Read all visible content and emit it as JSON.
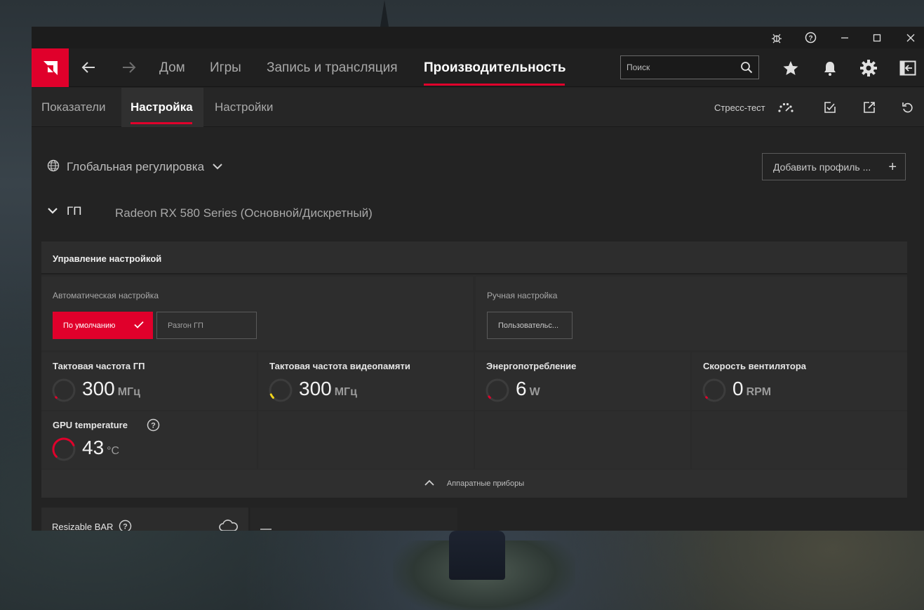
{
  "topnav": {
    "items": [
      "Дом",
      "Игры",
      "Запись и трансляция",
      "Производительность"
    ],
    "active": "Производительность",
    "search_placeholder": "Поиск"
  },
  "subnav": {
    "tabs": [
      "Показатели",
      "Настройка",
      "Настройки"
    ],
    "active": "Настройка",
    "stress_test": "Стресс-тест"
  },
  "profile": {
    "label": "Глобальная регулировка",
    "add_profile": "Добавить профиль ..."
  },
  "gpu": {
    "label": "ГП",
    "name": "Radeon RX 580 Series (Основной/Дискретный)"
  },
  "tuning": {
    "title": "Управление настройкой",
    "auto_label": "Автоматическая настройка",
    "default_btn": "По умолчанию",
    "oc_btn": "Разгон ГП",
    "manual_label": "Ручная настройка",
    "custom_btn": "Пользовательс..."
  },
  "metrics": [
    {
      "title": "Тактовая частота ГП",
      "value": "300",
      "unit": "МГц",
      "fraction": 0.0,
      "color": "#e0002b"
    },
    {
      "title": "Тактовая частота видеопамяти",
      "value": "300",
      "unit": "МГц",
      "fraction": 0.08,
      "color": "#f2d51c"
    },
    {
      "title": "Энергопотребление",
      "value": "6",
      "unit": "W",
      "fraction": 0.03,
      "color": "#e0002b"
    },
    {
      "title": "Скорость вентилятора",
      "value": "0",
      "unit": "RPM",
      "fraction": 0.0,
      "color": "#e0002b"
    },
    {
      "title": "GPU temperature",
      "value": "43",
      "unit": "°C",
      "fraction": 0.75,
      "color": "#e0002b"
    }
  ],
  "hardware_toggle": "Аппаратные приборы",
  "resizable_bar": "Resizable BAR",
  "colors": {
    "accent": "#e0002b",
    "window_bg": "#232323",
    "panel_bg": "#2d2d2d"
  }
}
